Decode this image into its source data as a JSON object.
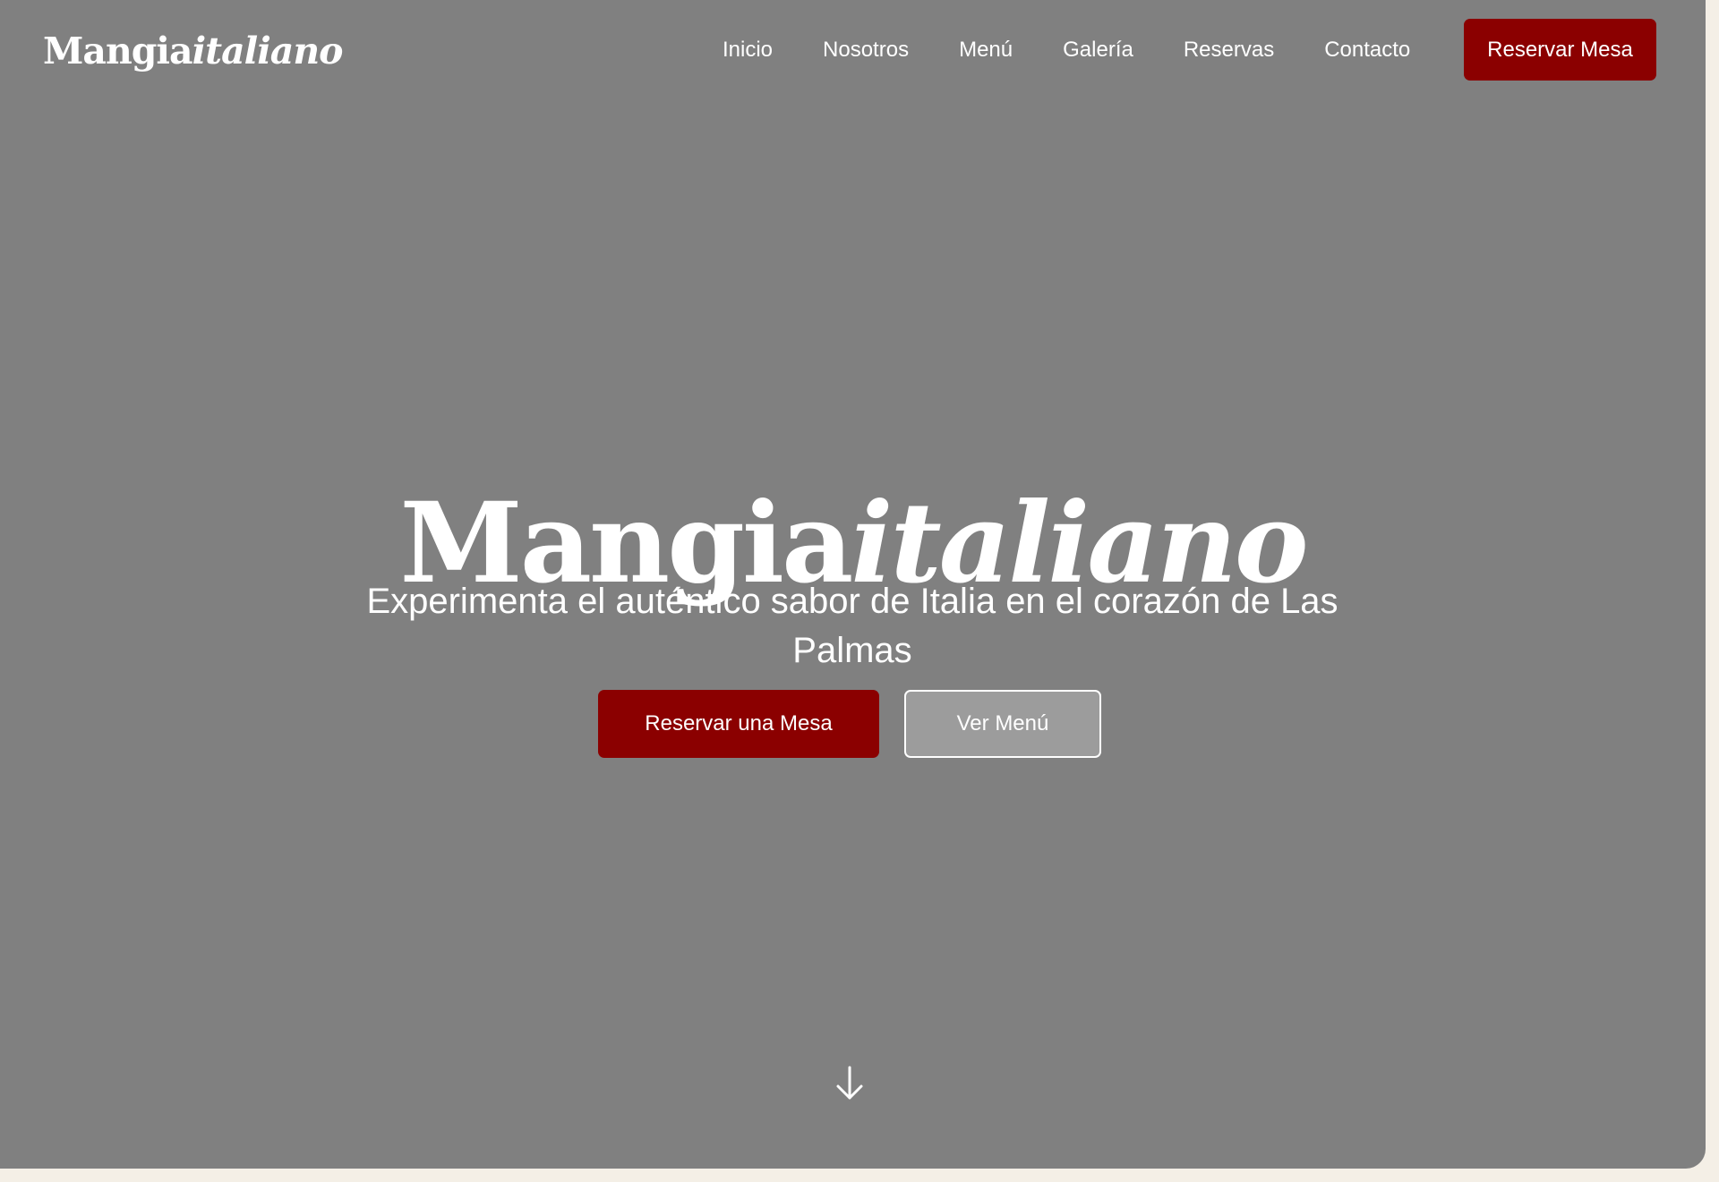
{
  "brand": {
    "name_regular": "Mangia",
    "name_italic": "italiano"
  },
  "nav": {
    "links": [
      "Inicio",
      "Nosotros",
      "Menú",
      "Galería",
      "Reservas",
      "Contacto"
    ],
    "cta_label": "Reservar Mesa"
  },
  "hero": {
    "title_regular": "Mangia",
    "title_italic": "italiano",
    "subtitle": "Experimenta el auténtico sabor de Italia en el corazón de Las Palmas",
    "primary_button": "Reservar una Mesa",
    "secondary_button": "Ver Menú",
    "scroll_icon": "arrow-down-icon"
  },
  "colors": {
    "overlay_background": "#808080",
    "accent": "#8b0000",
    "text": "#ffffff",
    "page_edge": "#f4efe6"
  }
}
